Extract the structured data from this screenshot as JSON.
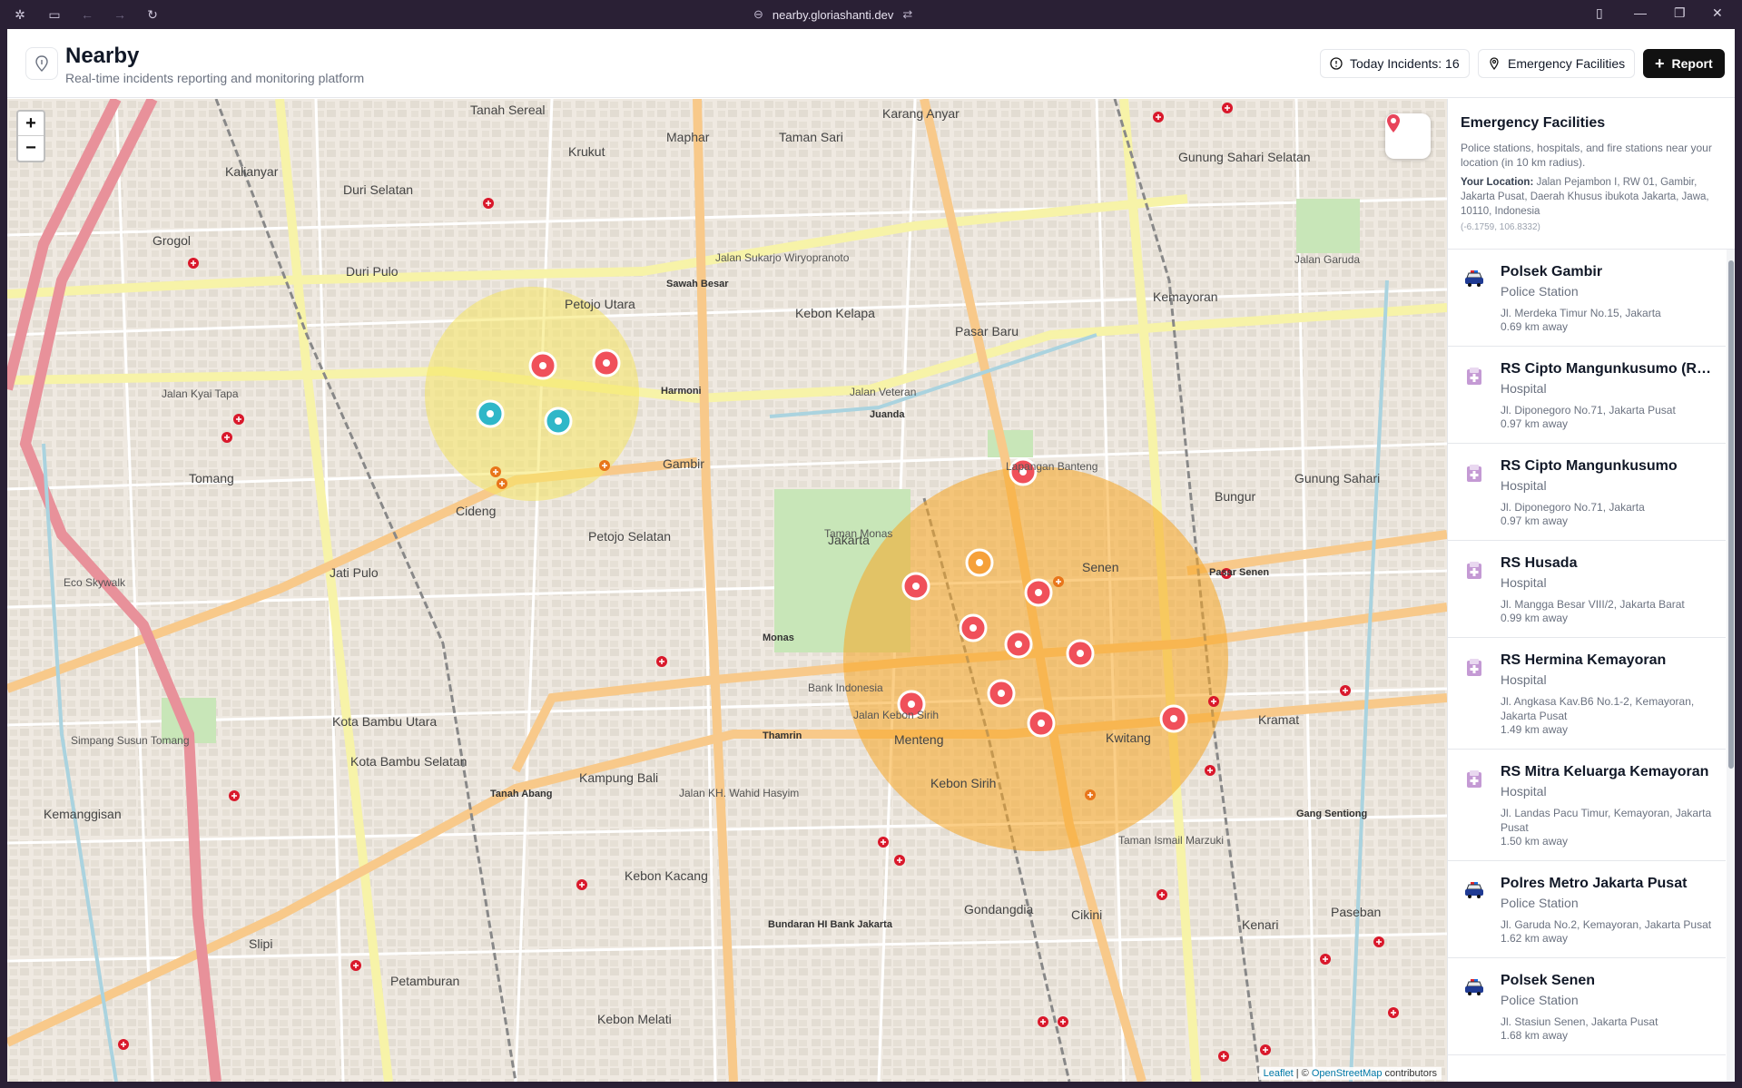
{
  "browser": {
    "url": "nearby.gloriashanti.dev"
  },
  "header": {
    "title": "Nearby",
    "subtitle": "Real-time incidents reporting and monitoring platform",
    "incidents_label": "Today Incidents: 16",
    "facilities_label": "Emergency Facilities",
    "report_label": "Report"
  },
  "map": {
    "zoom_in": "+",
    "zoom_out": "−",
    "attribution": {
      "leaflet": "Leaflet",
      "sep": " | © ",
      "osm": "OpenStreetMap",
      "suffix": " contributors"
    },
    "labels": [
      {
        "text": "Tanah Sereal",
        "cls": "big"
      },
      {
        "text": "Krukut",
        "cls": "big"
      },
      {
        "text": "Maphar",
        "cls": "big"
      },
      {
        "text": "Taman Sari",
        "cls": "big"
      },
      {
        "text": "Karang Anyar",
        "cls": "big"
      },
      {
        "text": "Gunung Sahari Selatan",
        "cls": "big"
      },
      {
        "text": "Kalianyar",
        "cls": "big"
      },
      {
        "text": "Duri Selatan",
        "cls": "big"
      },
      {
        "text": "Grogol",
        "cls": "big"
      },
      {
        "text": "Duri Pulo",
        "cls": "big"
      },
      {
        "text": "Petojo Utara",
        "cls": "big"
      },
      {
        "text": "Kebon Kelapa",
        "cls": "big"
      },
      {
        "text": "Pasar Baru",
        "cls": "big"
      },
      {
        "text": "Kemayoran",
        "cls": "big"
      },
      {
        "text": "Gambir",
        "cls": "big"
      },
      {
        "text": "Tomang",
        "cls": "big"
      },
      {
        "text": "Cideng",
        "cls": "big"
      },
      {
        "text": "Petojo Selatan",
        "cls": "big"
      },
      {
        "text": "Jakarta",
        "cls": "big"
      },
      {
        "text": "Senen",
        "cls": "big"
      },
      {
        "text": "Bungur",
        "cls": "big"
      },
      {
        "text": "Jati Pulo",
        "cls": "big"
      },
      {
        "text": "Gunung Sahari",
        "cls": "big"
      },
      {
        "text": "Kramat",
        "cls": "big"
      },
      {
        "text": "Kwitang",
        "cls": "big"
      },
      {
        "text": "Kebon Sirih",
        "cls": "big"
      },
      {
        "text": "Kampung Bali",
        "cls": "big"
      },
      {
        "text": "Kota Bambu Utara",
        "cls": "big"
      },
      {
        "text": "Kota Bambu Selatan",
        "cls": "big"
      },
      {
        "text": "Kemanggisan",
        "cls": "big"
      },
      {
        "text": "Gondangdia",
        "cls": "big"
      },
      {
        "text": "Kebon Kacang",
        "cls": "big"
      },
      {
        "text": "Cikini",
        "cls": "big"
      },
      {
        "text": "Kenari",
        "cls": "big"
      },
      {
        "text": "Paseban",
        "cls": "big"
      },
      {
        "text": "Petamburan",
        "cls": "big"
      },
      {
        "text": "Kebon Melati",
        "cls": "big"
      },
      {
        "text": "Slipi",
        "cls": "big"
      },
      {
        "text": "Menteng",
        "cls": "big"
      },
      {
        "text": "Jalan Kyai Tapa",
        "cls": ""
      },
      {
        "text": "Jalan Veteran",
        "cls": ""
      },
      {
        "text": "Jalan Kebon Sirih",
        "cls": ""
      },
      {
        "text": "Jalan KH. Wahid Hasyim",
        "cls": ""
      },
      {
        "text": "Jalan Garuda",
        "cls": ""
      },
      {
        "text": "Jalan Sukarjo Wiryopranoto",
        "cls": ""
      },
      {
        "text": "Harmoni",
        "cls": "st"
      },
      {
        "text": "Juanda",
        "cls": "st"
      },
      {
        "text": "Monas",
        "cls": "st"
      },
      {
        "text": "Thamrin",
        "cls": "st"
      },
      {
        "text": "Tanah Abang",
        "cls": "st"
      },
      {
        "text": "Sawah Besar",
        "cls": "st"
      },
      {
        "text": "Pasar Senen",
        "cls": "st"
      },
      {
        "text": "Gang Sentiong",
        "cls": "st"
      },
      {
        "text": "Bundaran HI Bank Jakarta",
        "cls": "st"
      },
      {
        "text": "Eco Skywalk",
        "cls": ""
      },
      {
        "text": "Simpang Susun Tomang",
        "cls": ""
      },
      {
        "text": "Bank Indonesia",
        "cls": ""
      },
      {
        "text": "Taman Monas",
        "cls": ""
      },
      {
        "text": "Lapangan Banteng",
        "cls": ""
      },
      {
        "text": "Taman Ismail Marzuki",
        "cls": ""
      }
    ]
  },
  "sidebar": {
    "title": "Emergency Facilities",
    "description": "Police stations, hospitals, and fire stations near your location (in 10 km radius).",
    "location_label": "Your Location:",
    "location_value": "Jalan Pejambon I, RW 01, Gambir, Jakarta Pusat, Daerah Khusus ibukota Jakarta, Jawa, 10110, Indonesia",
    "coords": "(-6.1759, 106.8332)",
    "items": [
      {
        "name": "Polsek Gambir",
        "type": "Police Station",
        "address": "Jl. Merdeka Timur No.15, Jakarta",
        "distance": "0.69 km away",
        "icon": "police-car-icon"
      },
      {
        "name": "RS Cipto Mangunkusumo (RS...",
        "type": "Hospital",
        "address": "Jl. Diponegoro No.71, Jakarta Pusat",
        "distance": "0.97 km away",
        "icon": "hospital-icon"
      },
      {
        "name": "RS Cipto Mangunkusumo",
        "type": "Hospital",
        "address": "Jl. Diponegoro No.71, Jakarta",
        "distance": "0.97 km away",
        "icon": "hospital-icon"
      },
      {
        "name": "RS Husada",
        "type": "Hospital",
        "address": "Jl. Mangga Besar VIII/2, Jakarta Barat",
        "distance": "0.99 km away",
        "icon": "hospital-icon"
      },
      {
        "name": "RS Hermina Kemayoran",
        "type": "Hospital",
        "address": "Jl. Angkasa Kav.B6 No.1-2, Kemayoran, Jakarta Pusat",
        "distance": "1.49 km away",
        "icon": "hospital-icon"
      },
      {
        "name": "RS Mitra Keluarga Kemayoran",
        "type": "Hospital",
        "address": "Jl. Landas Pacu Timur, Kemayoran, Jakarta Pusat",
        "distance": "1.50 km away",
        "icon": "hospital-icon"
      },
      {
        "name": "Polres Metro Jakarta Pusat",
        "type": "Police Station",
        "address": "Jl. Garuda No.2, Kemayoran, Jakarta Pusat",
        "distance": "1.62 km away",
        "icon": "police-car-icon"
      },
      {
        "name": "Polsek Senen",
        "type": "Police Station",
        "address": "Jl. Stasiun Senen, Jakarta Pusat",
        "distance": "1.68 km away",
        "icon": "police-car-icon"
      }
    ]
  },
  "colors": {
    "incident_red": "#f0505a",
    "incident_orange": "#f6a13a",
    "incident_teal": "#2fb7c8",
    "zone_yellow": "#f5e663",
    "zone_orange": "#f7a622",
    "facility_red": "#d9182b"
  }
}
